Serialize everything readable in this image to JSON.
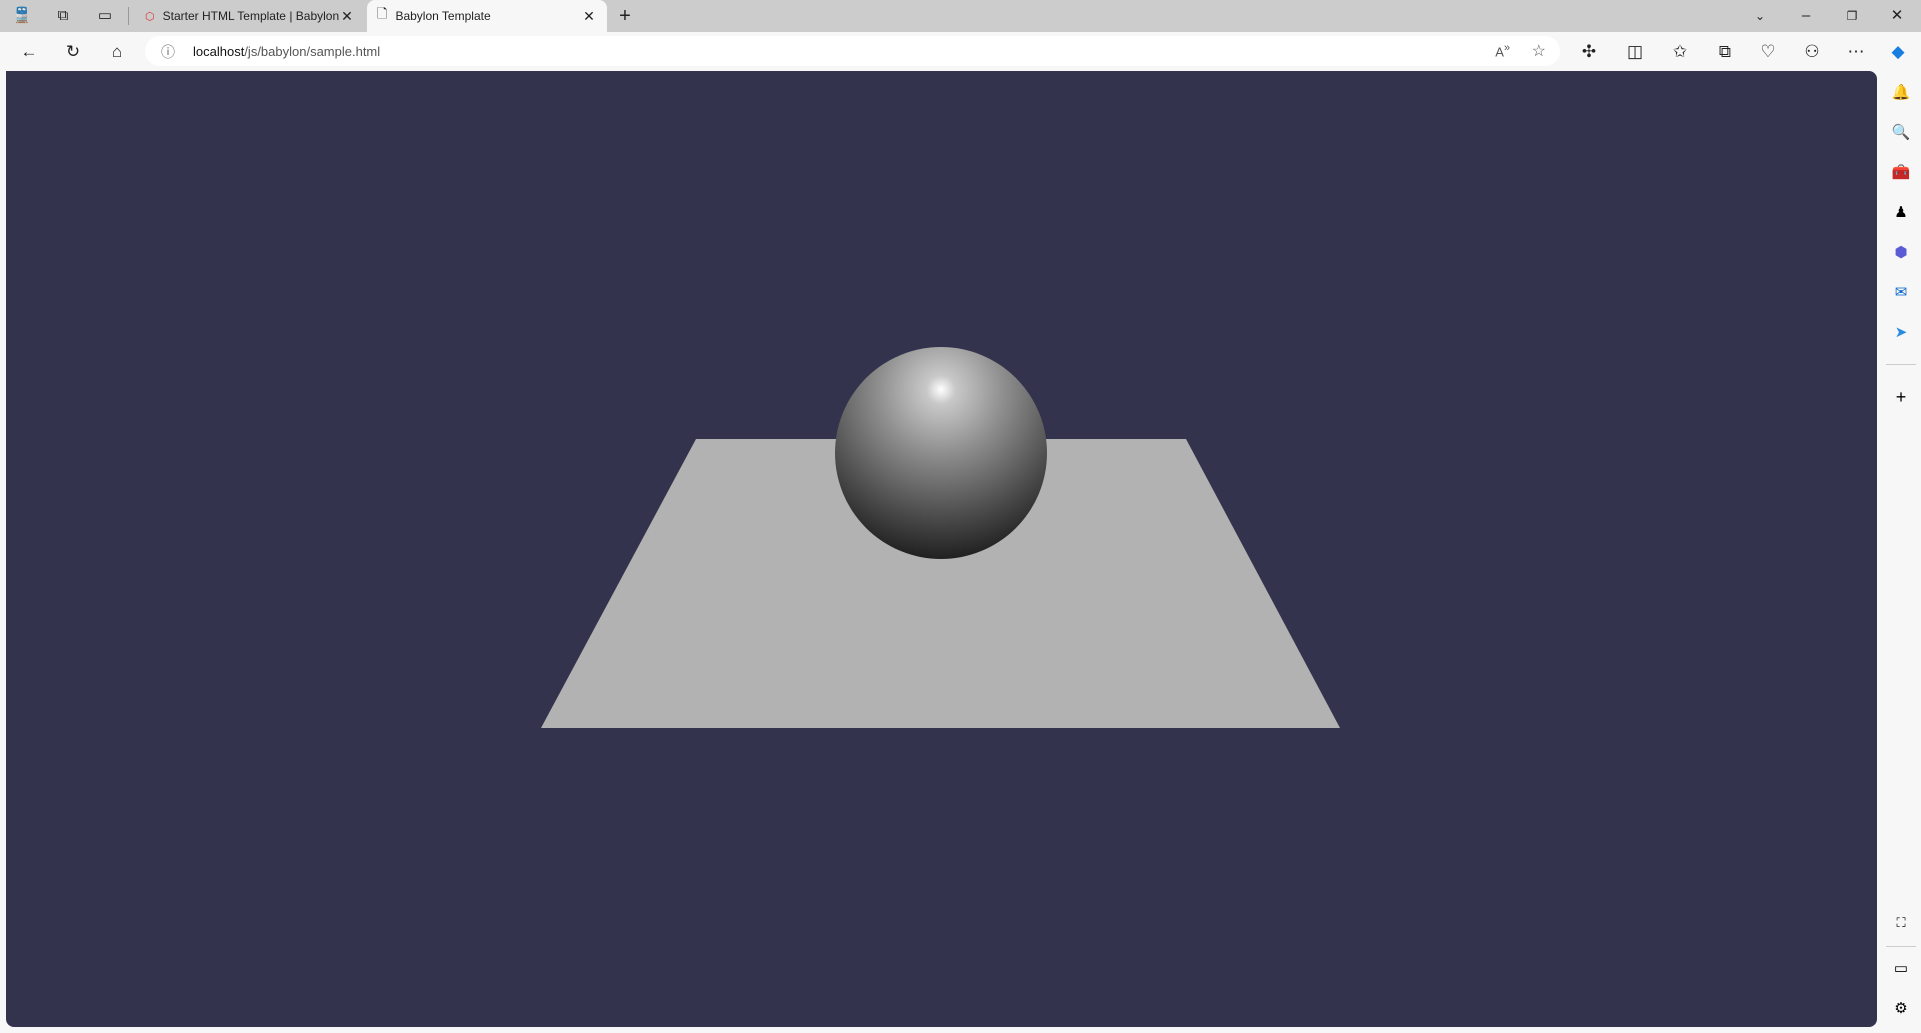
{
  "tabs": [
    {
      "title": "Starter HTML Template | Babylon.js Documentation",
      "icon": "babylon-logo-icon",
      "active": false
    },
    {
      "title": "Babylon Template",
      "icon": "page-icon",
      "active": true
    }
  ],
  "address": {
    "host": "localhost",
    "path": "/js/babylon/sample.html"
  },
  "scene": {
    "background": "#33334d",
    "ground_color": "#b2b2b2",
    "sphere_color": "#a0a0a0"
  },
  "sidebar": [
    "bell-icon",
    "search-icon",
    "toolbox-icon",
    "games-icon",
    "copilot-365-icon",
    "outlook-icon",
    "send-icon"
  ]
}
